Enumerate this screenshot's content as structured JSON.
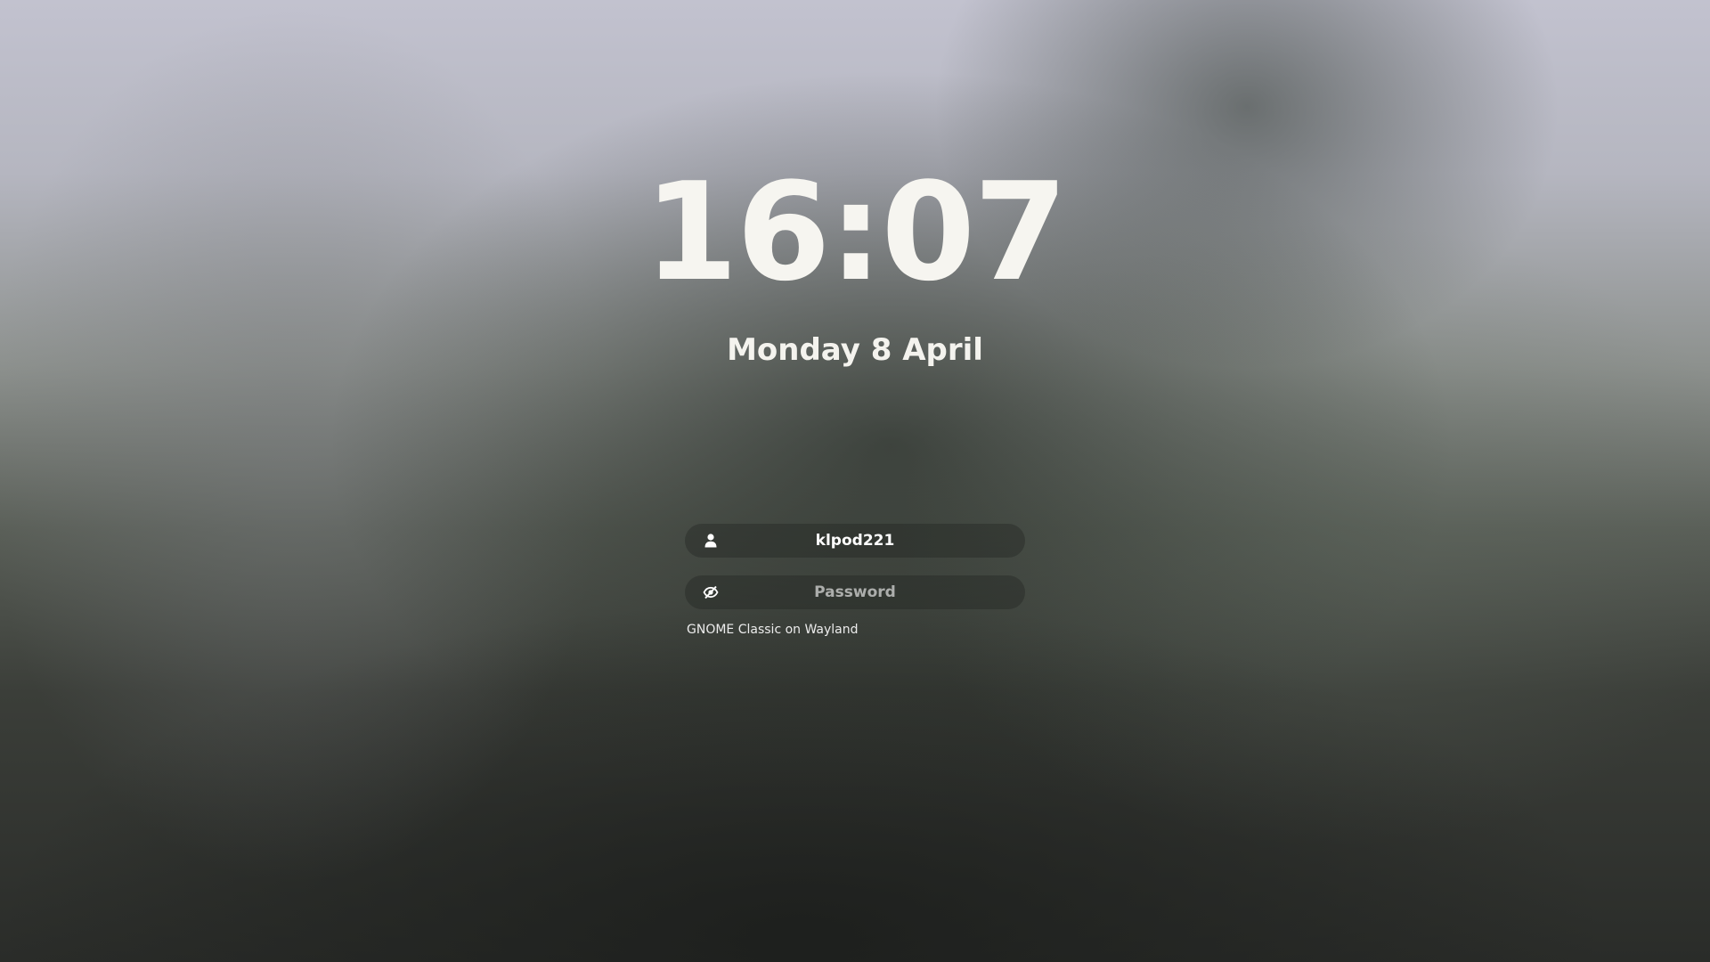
{
  "clock": {
    "time": "16:07",
    "date": "Monday 8 April"
  },
  "login": {
    "username": "klpod221",
    "username_icon": "user-icon",
    "password_placeholder": "Password",
    "password_icon": "eye-hidden-icon",
    "session": "GNOME Classic on Wayland"
  },
  "colors": {
    "text": "#f6f5f0",
    "field_bg": "rgba(30,32,30,0.35)"
  }
}
